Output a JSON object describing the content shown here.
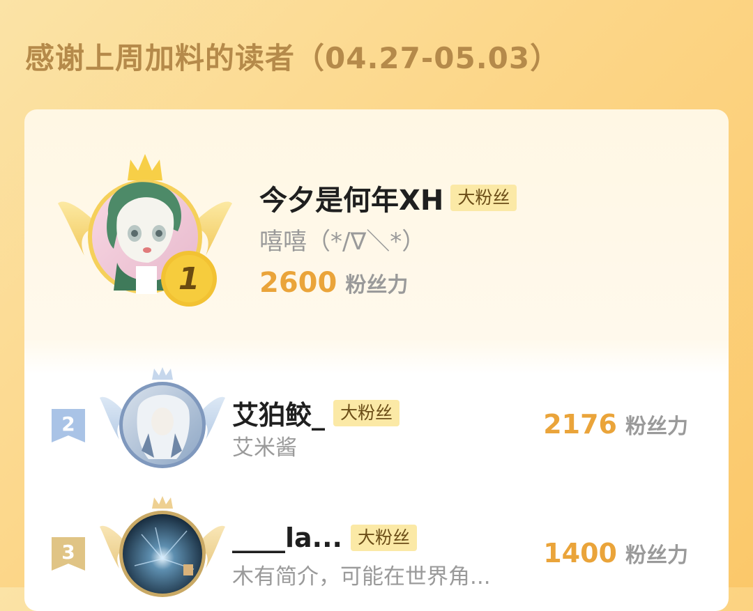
{
  "header": {
    "title": "感谢上周加料的读者（04.27-05.03）"
  },
  "ranking": [
    {
      "rank": "1",
      "name": "今夕是何年XH",
      "tag": "大粉丝",
      "bio": "嘻嘻（*/∇＼*）",
      "score": "2600",
      "unit": "粉丝力"
    },
    {
      "rank": "2",
      "name": "艾狛鲛_",
      "tag": "大粉丝",
      "bio": "艾米酱",
      "score": "2176",
      "unit": "粉丝力"
    },
    {
      "rank": "3",
      "name": "____la...",
      "tag": "大粉丝",
      "bio": "木有简介，可能在世界角...",
      "score": "1400",
      "unit": "粉丝力"
    }
  ],
  "colors": {
    "gold": "#f2c233",
    "silver": "#a9c3e6",
    "bronze": "#e0c485",
    "score": "#eaa43a"
  },
  "icons": {
    "crown": "crown-icon",
    "wings": "wings-icon",
    "medal": "rank-medal-icon",
    "flag": "rank-flag-icon"
  }
}
